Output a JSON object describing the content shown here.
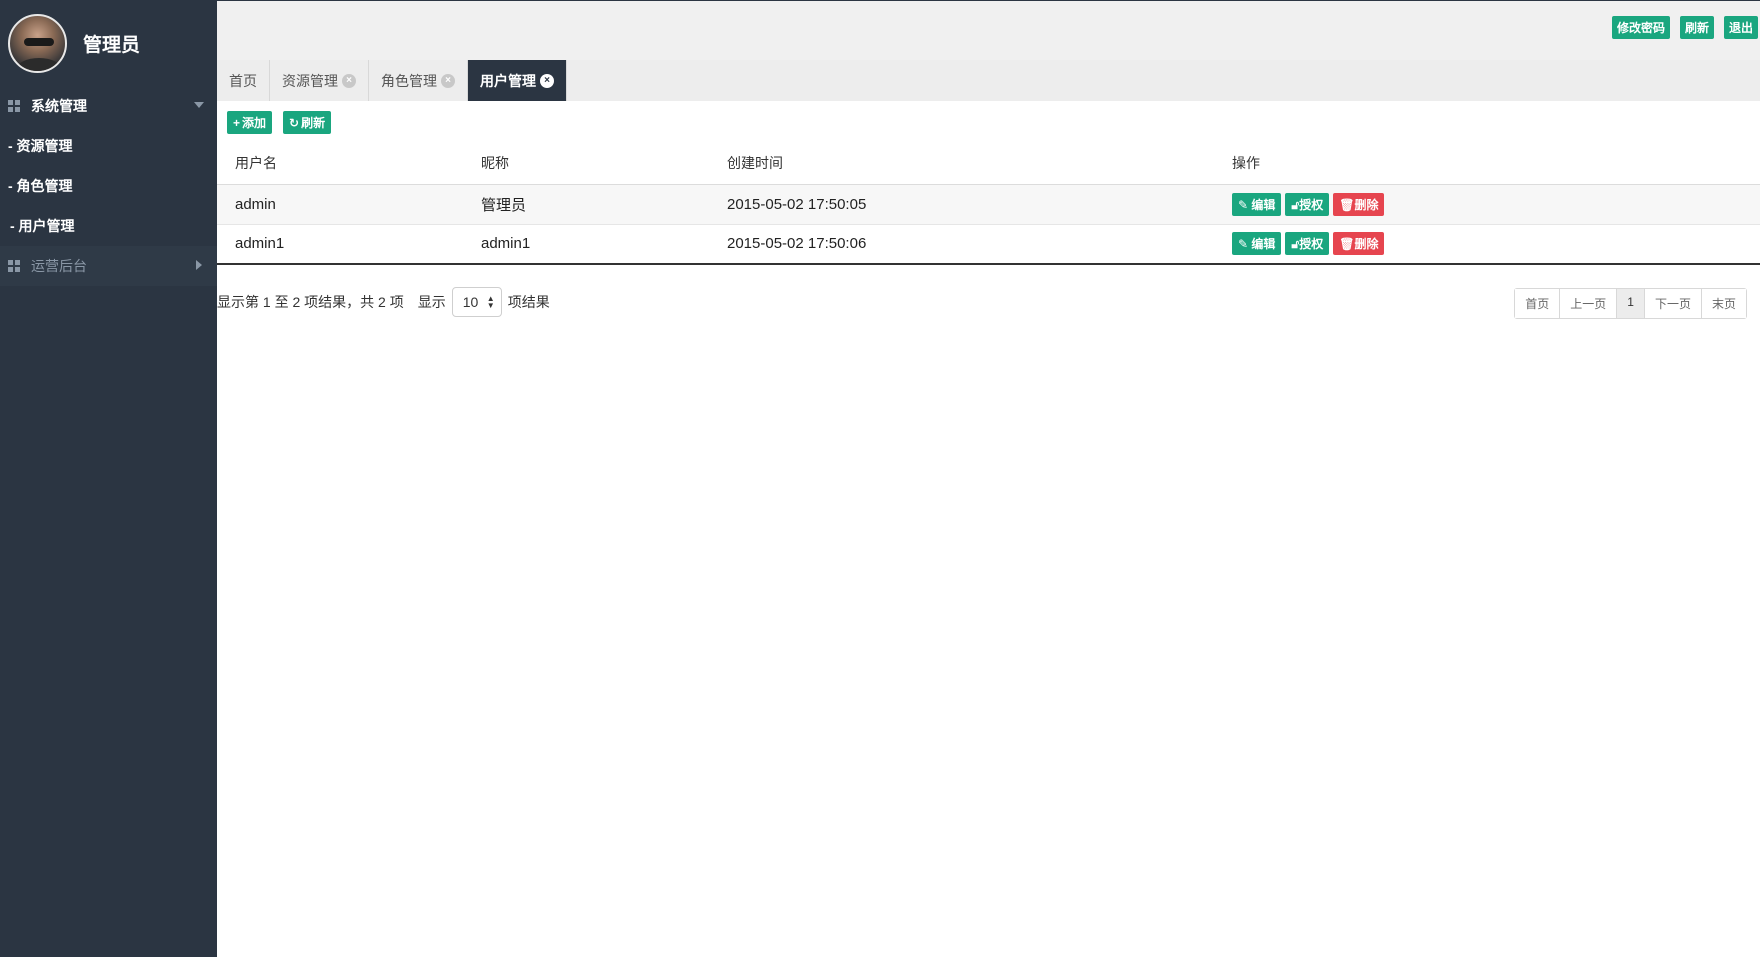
{
  "sidebar": {
    "profile_name": "管理员",
    "groups": [
      {
        "label": "系统管理",
        "expanded": true,
        "items": [
          "- 资源管理",
          "- 角色管理",
          "- 用户管理"
        ]
      },
      {
        "label": "运营后台",
        "expanded": false
      }
    ]
  },
  "header": {
    "buttons": [
      "修改密码",
      "刷新",
      "退出"
    ]
  },
  "tabs": [
    {
      "label": "首页",
      "closable": false,
      "active": false
    },
    {
      "label": "资源管理",
      "closable": true,
      "active": false
    },
    {
      "label": "角色管理",
      "closable": true,
      "active": false
    },
    {
      "label": "用户管理",
      "closable": true,
      "active": true
    }
  ],
  "toolbar": {
    "add_label": "添加",
    "refresh_label": "刷新"
  },
  "table": {
    "columns": [
      "用户名",
      "昵称",
      "创建时间",
      "操作"
    ],
    "rows": [
      {
        "username": "admin",
        "nickname": "管理员",
        "created": "2015-05-02 17:50:05"
      },
      {
        "username": "admin1",
        "nickname": "admin1",
        "created": "2015-05-02 17:50:06"
      }
    ],
    "actions": {
      "edit": "编辑",
      "grant": "授权",
      "delete": "删除"
    }
  },
  "footer": {
    "info": "显示第 1 至 2 项结果，共 2 项",
    "show_label": "显示",
    "page_size": "10",
    "results_label": "项结果"
  },
  "pager": {
    "first": "首页",
    "prev": "上一页",
    "current": "1",
    "next": "下一页",
    "last": "末页"
  },
  "colors": {
    "sidebar_bg": "#2b3542",
    "accent_green": "#1aa67f",
    "danger_red": "#e6454f"
  }
}
